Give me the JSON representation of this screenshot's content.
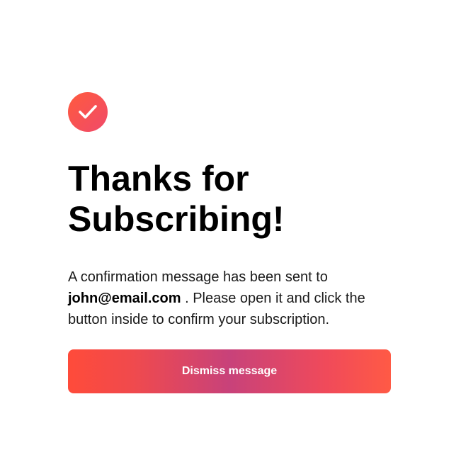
{
  "success_icon": "checkmark-icon",
  "title": "Thanks for Subscribing!",
  "message": {
    "prefix": "A confirmation message has been sent to",
    "email": "john@email.com",
    "suffix": ". Please open it and click the button inside to confirm your subscription."
  },
  "dismiss_button": {
    "label": "Dismiss message"
  },
  "colors": {
    "accent_start": "#ff4b3a",
    "accent_mid": "#c8427a",
    "accent_end": "#ff5a45"
  }
}
